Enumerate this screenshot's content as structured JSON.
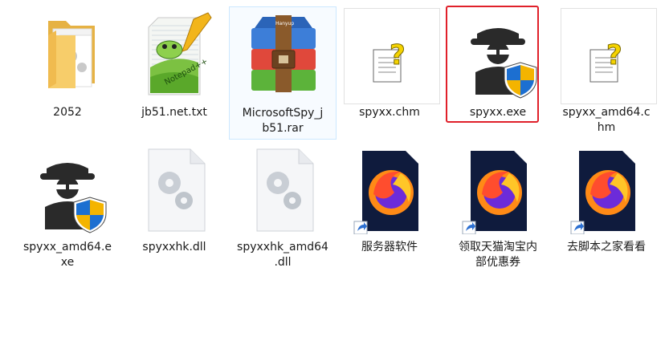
{
  "files": [
    {
      "label_lines": [
        "2052"
      ],
      "icon": "folder-icon"
    },
    {
      "label_lines": [
        "jb51.net.txt"
      ],
      "icon": "notepadpp-text-file-icon"
    },
    {
      "label_lines": [
        "MicrosoftSpy_j",
        "b51.rar"
      ],
      "icon": "winrar-archive-icon",
      "selected": true
    },
    {
      "label_lines": [
        "spyxx.chm"
      ],
      "icon": "help-file-icon"
    },
    {
      "label_lines": [
        "spyxx.exe"
      ],
      "icon": "spy-shield-exe-icon",
      "highlighted": true
    },
    {
      "label_lines": [
        "spyxx_amd64.c",
        "hm"
      ],
      "icon": "help-file-icon"
    },
    {
      "label_lines": [
        "spyxx_amd64.e",
        "xe"
      ],
      "icon": "spy-shield-exe-icon"
    },
    {
      "label_lines": [
        "spyxxhk.dll"
      ],
      "icon": "dll-gears-icon"
    },
    {
      "label_lines": [
        "spyxxhk_amd64",
        ".dll"
      ],
      "icon": "dll-gears-icon"
    },
    {
      "label_lines": [
        "服务器软件"
      ],
      "icon": "firefox-shortcut-icon"
    },
    {
      "label_lines": [
        "领取天猫淘宝内",
        "部优惠券"
      ],
      "icon": "firefox-shortcut-icon"
    },
    {
      "label_lines": [
        "去脚本之家看看"
      ],
      "icon": "firefox-shortcut-icon"
    }
  ],
  "colors": {
    "highlight_border": "#e0202a",
    "selection_border": "#cce8ff",
    "folder": "#f5c35b",
    "shield_blue": "#1c6fd1",
    "shield_yellow": "#f4b400"
  }
}
